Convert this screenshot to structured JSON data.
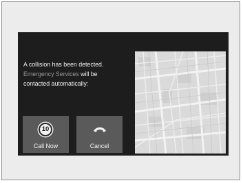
{
  "dialog": {
    "message_line1": "A collision has been detected.",
    "message_highlight": "Emergency Services",
    "message_line2_rest": " will be",
    "message_line3": "contacted automatically:"
  },
  "buttons": {
    "call_now": {
      "countdown": "10",
      "label": "Call Now",
      "icon": "countdown-ring-icon"
    },
    "cancel": {
      "label": "Cancel",
      "icon": "phone-hangup-icon"
    }
  },
  "map": {
    "icon": "street-map"
  }
}
